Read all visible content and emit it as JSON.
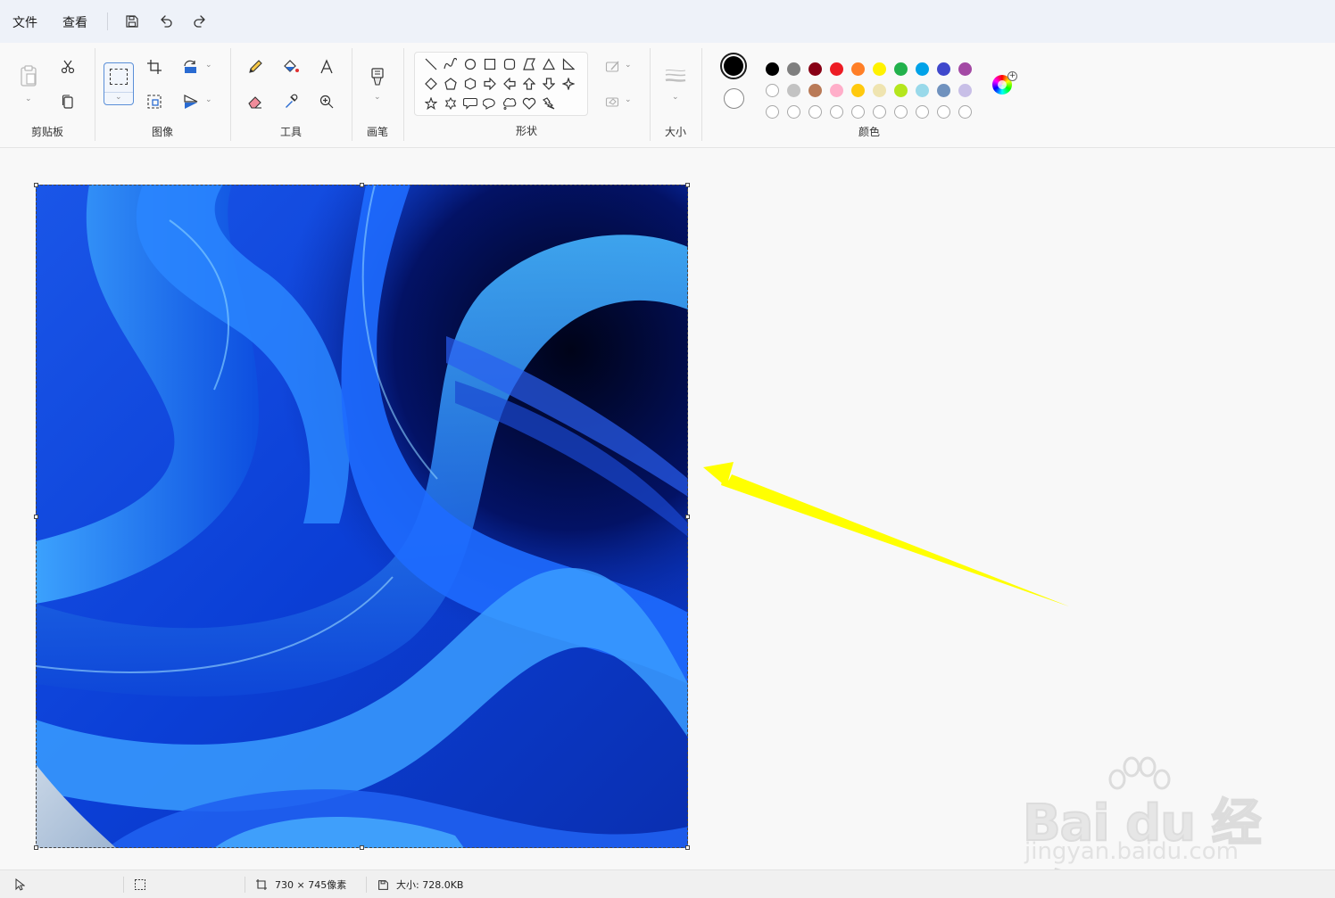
{
  "menu": {
    "file": "文件",
    "view": "查看"
  },
  "ribbon": {
    "clipboard_label": "剪贴板",
    "image_label": "图像",
    "tools_label": "工具",
    "brush_label": "画笔",
    "shapes_label": "形状",
    "size_label": "大小",
    "colors_label": "颜色"
  },
  "colors": {
    "primary": "#000000",
    "secondary": "#ffffff",
    "row1": [
      "#000000",
      "#7f7f7f",
      "#880015",
      "#ed1c24",
      "#ff7f27",
      "#fff200",
      "#22b14c",
      "#00a2e8",
      "#3f48cc",
      "#a349a4"
    ],
    "row2": [
      "#ffffff",
      "#c3c3c3",
      "#b97a57",
      "#ffaec9",
      "#ffc90e",
      "#efe4b0",
      "#b5e61d",
      "#99d9ea",
      "#7092be",
      "#c8bfe7"
    ]
  },
  "canvas": {
    "annotation_arrow_color": "#ffff00"
  },
  "watermark": {
    "brand": "Bai du 经验",
    "url": "jingyan.baidu.com"
  },
  "status": {
    "dimensions": "730 × 745像素",
    "file_size": "大小: 728.0KB"
  }
}
